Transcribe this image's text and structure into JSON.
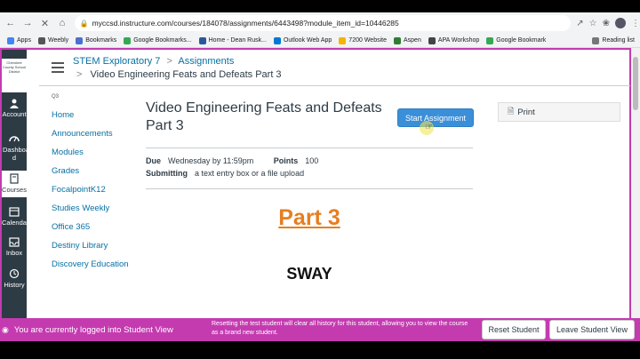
{
  "browser": {
    "url": "myccsd.instructure.com/courses/184078/assignments/6443498?module_item_id=10446285",
    "bookmarks": [
      {
        "label": "Apps",
        "color": "#4285f4"
      },
      {
        "label": "Weebly",
        "color": "#555555"
      },
      {
        "label": "Bookmarks",
        "color": "#4a6fd0"
      },
      {
        "label": "Google Bookmarks...",
        "color": "#34a853"
      },
      {
        "label": "Home - Dean Rusk...",
        "color": "#2b579a"
      },
      {
        "label": "Outlook Web App",
        "color": "#0078d4"
      },
      {
        "label": "7200 Website",
        "color": "#f4b400"
      },
      {
        "label": "Aspen",
        "color": "#2e7d32"
      },
      {
        "label": "APA Workshop",
        "color": "#444444"
      },
      {
        "label": "Google Bookmark",
        "color": "#34a853"
      }
    ],
    "reading_list": "Reading list"
  },
  "global_nav": {
    "logo_text": "Cherokee County School District",
    "items": [
      {
        "label": "Account",
        "icon": "account-icon"
      },
      {
        "label": "Dashboar d",
        "icon": "dashboard-icon"
      },
      {
        "label": "Courses",
        "icon": "courses-icon",
        "active": true
      },
      {
        "label": "Calendar",
        "icon": "calendar-icon"
      },
      {
        "label": "Inbox",
        "icon": "inbox-icon"
      },
      {
        "label": "History",
        "icon": "history-icon"
      }
    ]
  },
  "breadcrumb": {
    "course": "STEM Exploratory 7",
    "section": "Assignments",
    "current": "Video Engineering Feats and Defeats Part 3",
    "separator": ">"
  },
  "course_nav": {
    "term": "Q3",
    "links": [
      "Home",
      "Announcements",
      "Modules",
      "Grades",
      "FocalpointK12",
      "Studies Weekly",
      "Office 365",
      "Destiny Library",
      "Discovery Education"
    ]
  },
  "assignment": {
    "title": "Video Engineering Feats and Defeats Part 3",
    "start_label": "Start Assignment",
    "print_label": "Print",
    "due_label": "Due",
    "due_value": "Wednesday by 11:59pm",
    "points_label": "Points",
    "points_value": "100",
    "submitting_label": "Submitting",
    "submitting_value": "a text entry box or a file upload",
    "heading": "Part 3",
    "subheading": "SWAY"
  },
  "student_view": {
    "message": "You are currently logged into Student View",
    "note": "Resetting the test student will clear all history for this student, allowing you to view the course as a brand new student.",
    "reset_label": "Reset Student",
    "leave_label": "Leave Student View"
  },
  "colors": {
    "student_bar": "#c43bb0",
    "canvas_nav": "#2d3b45",
    "link": "#0770a3",
    "accent_heading": "#e67e22",
    "button": "#3a8fd8"
  }
}
